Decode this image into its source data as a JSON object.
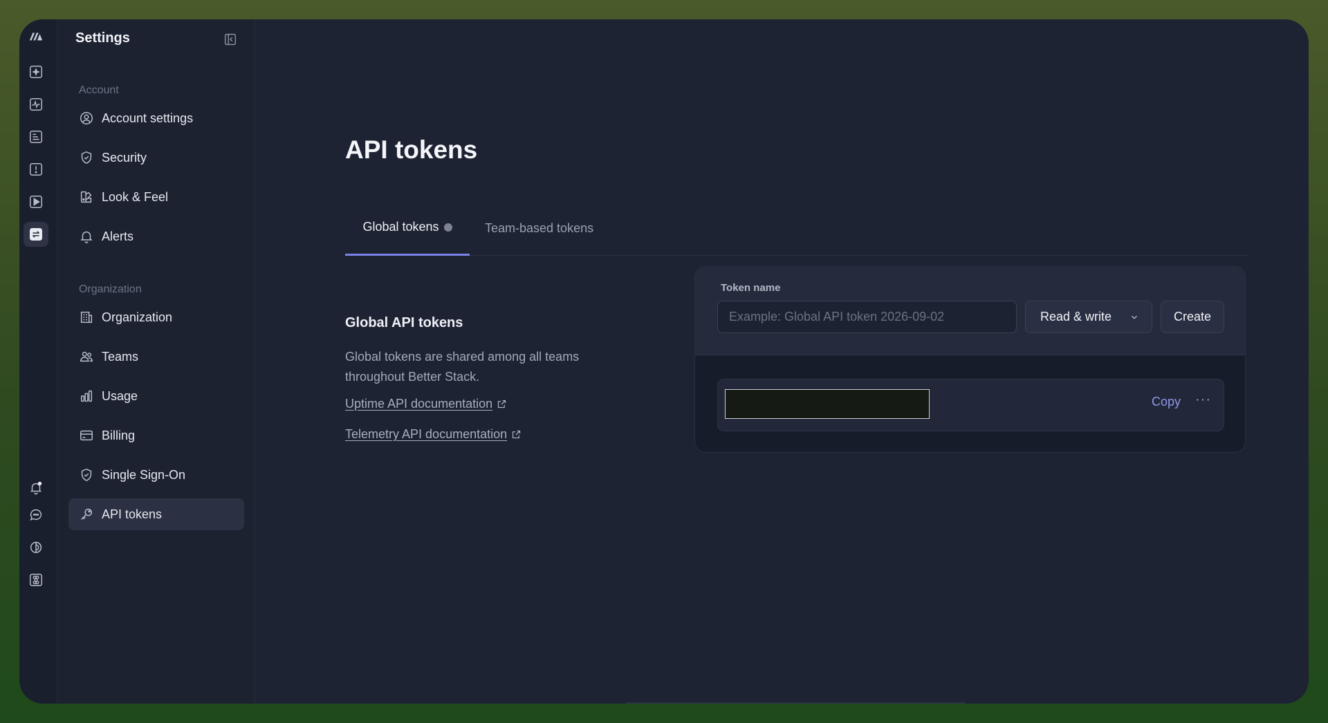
{
  "sidebar": {
    "title": "Settings",
    "account_section": "Account",
    "account_items": [
      {
        "label": "Account settings",
        "icon": "user-circle-icon"
      },
      {
        "label": "Security",
        "icon": "shield-check-icon"
      },
      {
        "label": "Look & Feel",
        "icon": "palette-icon"
      },
      {
        "label": "Alerts",
        "icon": "bell-icon"
      }
    ],
    "organization_section": "Organization",
    "organization_items": [
      {
        "label": "Organization",
        "icon": "building-icon"
      },
      {
        "label": "Teams",
        "icon": "users-icon"
      },
      {
        "label": "Usage",
        "icon": "bar-chart-icon"
      },
      {
        "label": "Billing",
        "icon": "credit-card-icon"
      },
      {
        "label": "Single Sign-On",
        "icon": "shield-check-icon"
      },
      {
        "label": "API tokens",
        "icon": "key-icon",
        "active": true
      }
    ]
  },
  "rail": {
    "items": [
      "logo-icon",
      "ai-sparkle-icon",
      "monitor-activity-icon",
      "logs-icon",
      "incident-icon",
      "playback-icon",
      "settings-toggle-icon"
    ],
    "bottom_items": [
      "notifications-icon",
      "chat-icon",
      "theme-icon",
      "command-icon"
    ]
  },
  "main": {
    "title": "API tokens",
    "tabs": [
      {
        "label": "Global tokens",
        "active": true
      },
      {
        "label": "Team-based tokens",
        "active": false
      }
    ],
    "section_title": "Global API tokens",
    "section_description": "Global tokens are shared among all teams throughout Better Stack.",
    "links": [
      {
        "label": "Uptime API documentation"
      },
      {
        "label": "Telemetry API documentation"
      }
    ],
    "form": {
      "label": "Token name",
      "placeholder": "Example: Global API token 2026-09-02",
      "value": "",
      "permission": "Read & write",
      "create_label": "Create"
    },
    "token": {
      "copy_label": "Copy",
      "more_label": "···"
    }
  },
  "colors": {
    "accent": "#7b84e8",
    "background": "#1e2333"
  }
}
